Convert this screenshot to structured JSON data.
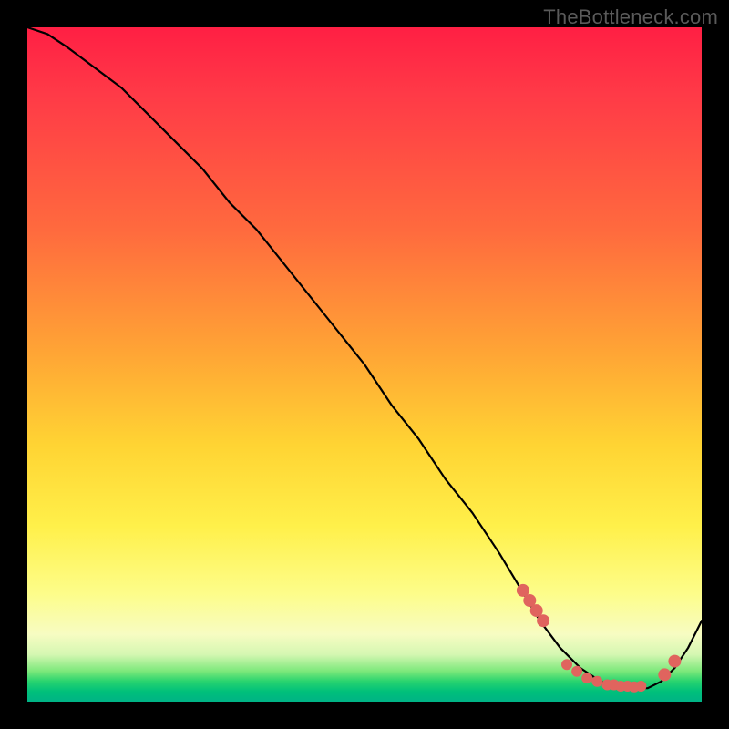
{
  "watermark": "TheBottleneck.com",
  "chart_data": {
    "type": "line",
    "title": "",
    "xlabel": "",
    "ylabel": "",
    "xlim": [
      0,
      100
    ],
    "ylim": [
      0,
      100
    ],
    "grid": false,
    "legend": false,
    "series": [
      {
        "name": "bottleneck-curve",
        "x": [
          0,
          3,
          6,
          10,
          14,
          18,
          22,
          26,
          30,
          34,
          38,
          42,
          46,
          50,
          54,
          58,
          62,
          66,
          70,
          73,
          76,
          79,
          82,
          85,
          88,
          90,
          92,
          94,
          96,
          98,
          100
        ],
        "y": [
          100,
          99,
          97,
          94,
          91,
          87,
          83,
          79,
          74,
          70,
          65,
          60,
          55,
          50,
          44,
          39,
          33,
          28,
          22,
          17,
          12,
          8,
          5,
          3,
          2,
          2,
          2,
          3,
          5,
          8,
          12
        ]
      }
    ],
    "markers": {
      "name": "highlight-dots",
      "x": [
        73.5,
        74.5,
        75.5,
        76.5,
        80,
        81.5,
        83,
        84.5,
        86,
        87,
        88,
        89,
        90,
        91,
        94.5,
        96
      ],
      "y": [
        16.5,
        15,
        13.5,
        12,
        5.5,
        4.5,
        3.5,
        3,
        2.5,
        2.5,
        2.3,
        2.3,
        2.2,
        2.3,
        4,
        6
      ]
    },
    "background_gradient": {
      "top": "#ff1f44",
      "mid": "#ffe84a",
      "bottom": "#00b386"
    }
  }
}
